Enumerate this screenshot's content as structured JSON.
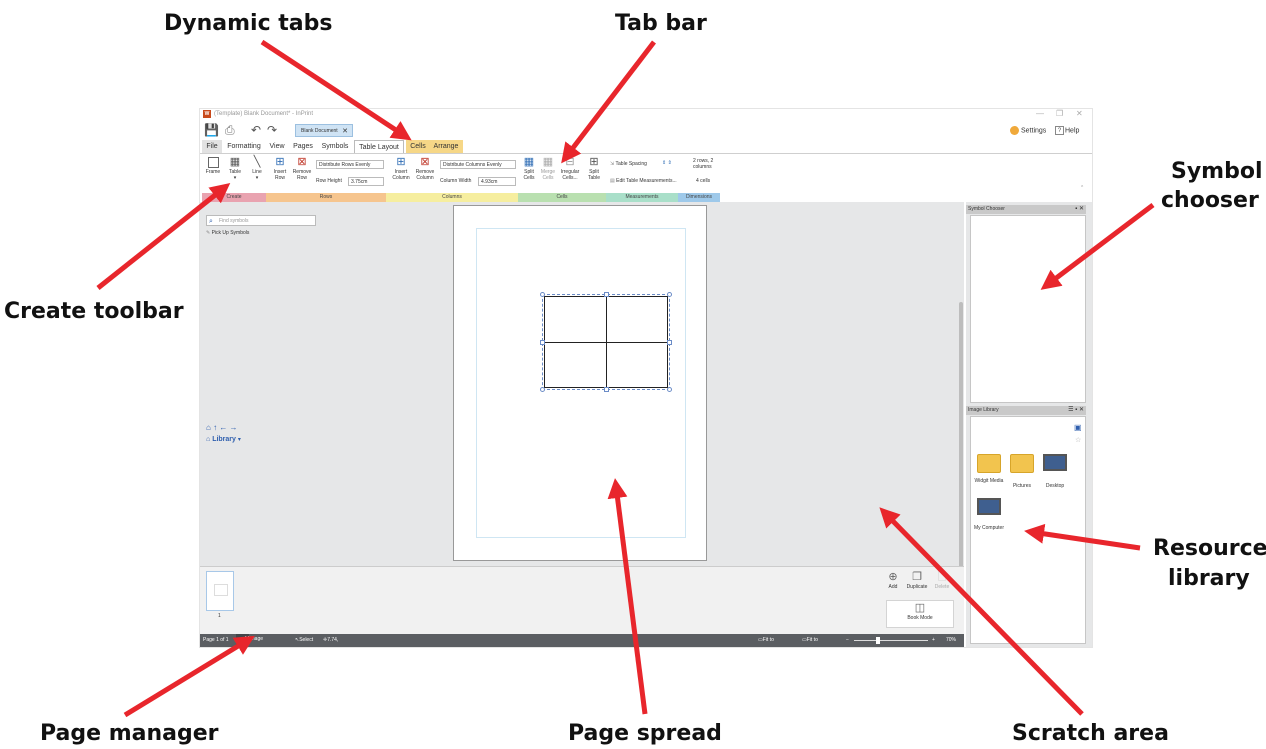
{
  "callouts": {
    "dynamic_tabs": "Dynamic tabs",
    "tab_bar": "Tab bar",
    "symbol_chooser_line1": "Symbol",
    "symbol_chooser_line2": "chooser",
    "create_toolbar": "Create toolbar",
    "resource_library_line1": "Resource",
    "resource_library_line2": "library",
    "page_manager": "Page manager",
    "page_spread": "Page spread",
    "scratch_area": "Scratch area"
  },
  "window": {
    "title": "(Template) Blank Document* - InPrint",
    "document_tab": "Blank Document",
    "settings": "Settings",
    "help": "Help"
  },
  "tabs": [
    "File",
    "Formatting",
    "View",
    "Pages",
    "Symbols",
    "Table Layout",
    "Cells",
    "Arrange"
  ],
  "ribbon": {
    "frame": "Frame",
    "table": "Table",
    "line": "Line",
    "insert_row": "Insert Row",
    "remove_row": "Remove Row",
    "distribute_rows": "Distribute Rows Evenly",
    "row_height_label": "Row Height",
    "row_height_value": "3.75cm",
    "insert_column": "Insert Column",
    "remove_column": "Remove Column",
    "distribute_columns": "Distribute Columns Evenly",
    "column_width_label": "Column Width",
    "column_width_value": "4.93cm",
    "split_cells": "Split Cells",
    "merge_cells": "Merge Cells",
    "irregular_cells": "Irregular Cells...",
    "split_table": "Split Table",
    "table_spacing": "Table Spacing",
    "edit_measurements": "Edit Table Measurements...",
    "dimensions_rows_cols": "2 rows, 2 columns",
    "dimensions_cells": "4 cells"
  },
  "groups": [
    "Create",
    "Rows",
    "Columns",
    "Cells",
    "Measurements",
    "Dimensions"
  ],
  "colors": {
    "create": "#e9a3b0",
    "rows": "#f6c58e",
    "columns": "#f6ee9f",
    "cells": "#b9e0b0",
    "measurements": "#a9dfc9",
    "dimensions": "#9ec9ea",
    "dynamic_tab": "#f6d787",
    "arrow": "#e8262c",
    "statusbar": "#5b5e62"
  },
  "symbol_chooser": {
    "title": "Symbol Chooser",
    "find_placeholder": "Find symbols",
    "pick_up": "Pick Up Symbols"
  },
  "image_library": {
    "title": "Image Library",
    "heading": "Library",
    "items": [
      "Widgit Media",
      "Pictures",
      "Desktop",
      "My Computer"
    ]
  },
  "page_manager": {
    "thumb_number": "1",
    "add": "Add",
    "duplicate": "Duplicate",
    "delete": "Delete",
    "book_mode": "Book Mode"
  },
  "statusbar": {
    "page": "Page 1 of 1",
    "manage_pages": "Manage Pages",
    "tool": "Select",
    "coords": "7.74, 7.76cm",
    "fit_width": "Fit to Width",
    "fit_height": "Fit to Height",
    "zoom": "70%"
  }
}
